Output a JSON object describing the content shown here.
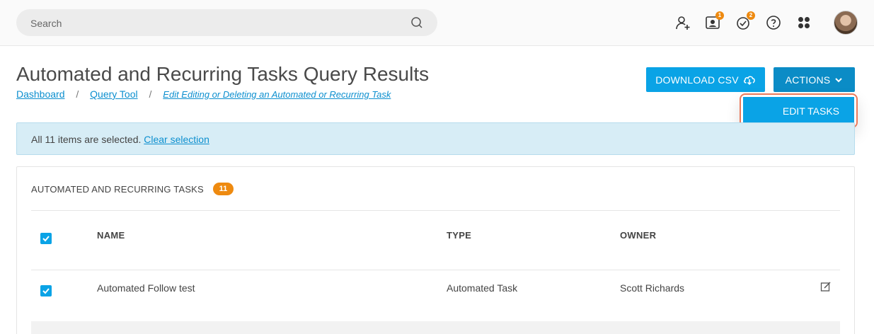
{
  "search": {
    "placeholder": "Search"
  },
  "topbar": {
    "icons": [
      "add-user-icon",
      "contact-card-icon",
      "tasks-check-icon",
      "help-icon",
      "apps-grid-icon"
    ],
    "contact_badge": "1",
    "tasks_badge": "2"
  },
  "header": {
    "title": "Automated and Recurring Tasks Query Results",
    "breadcrumbs": [
      "Dashboard",
      "Query Tool",
      "Edit Editing or Deleting an Automated or Recurring Task"
    ],
    "download_label": "DOWNLOAD CSV",
    "actions_label": "ACTIONS",
    "dropdown_item": "EDIT TASKS"
  },
  "alert": {
    "text": "All 11 items are selected.",
    "link": "Clear selection"
  },
  "panel": {
    "title": "AUTOMATED AND RECURRING TASKS",
    "count": "11",
    "columns": [
      "NAME",
      "TYPE",
      "OWNER"
    ],
    "rows": [
      {
        "name": "Automated Follow test",
        "type": "Automated Task",
        "owner": "Scott Richards",
        "checked": true
      }
    ]
  },
  "colors": {
    "accent": "#0aa3e6",
    "badge": "#ee8a10",
    "highlight": "#ea7a5b"
  }
}
